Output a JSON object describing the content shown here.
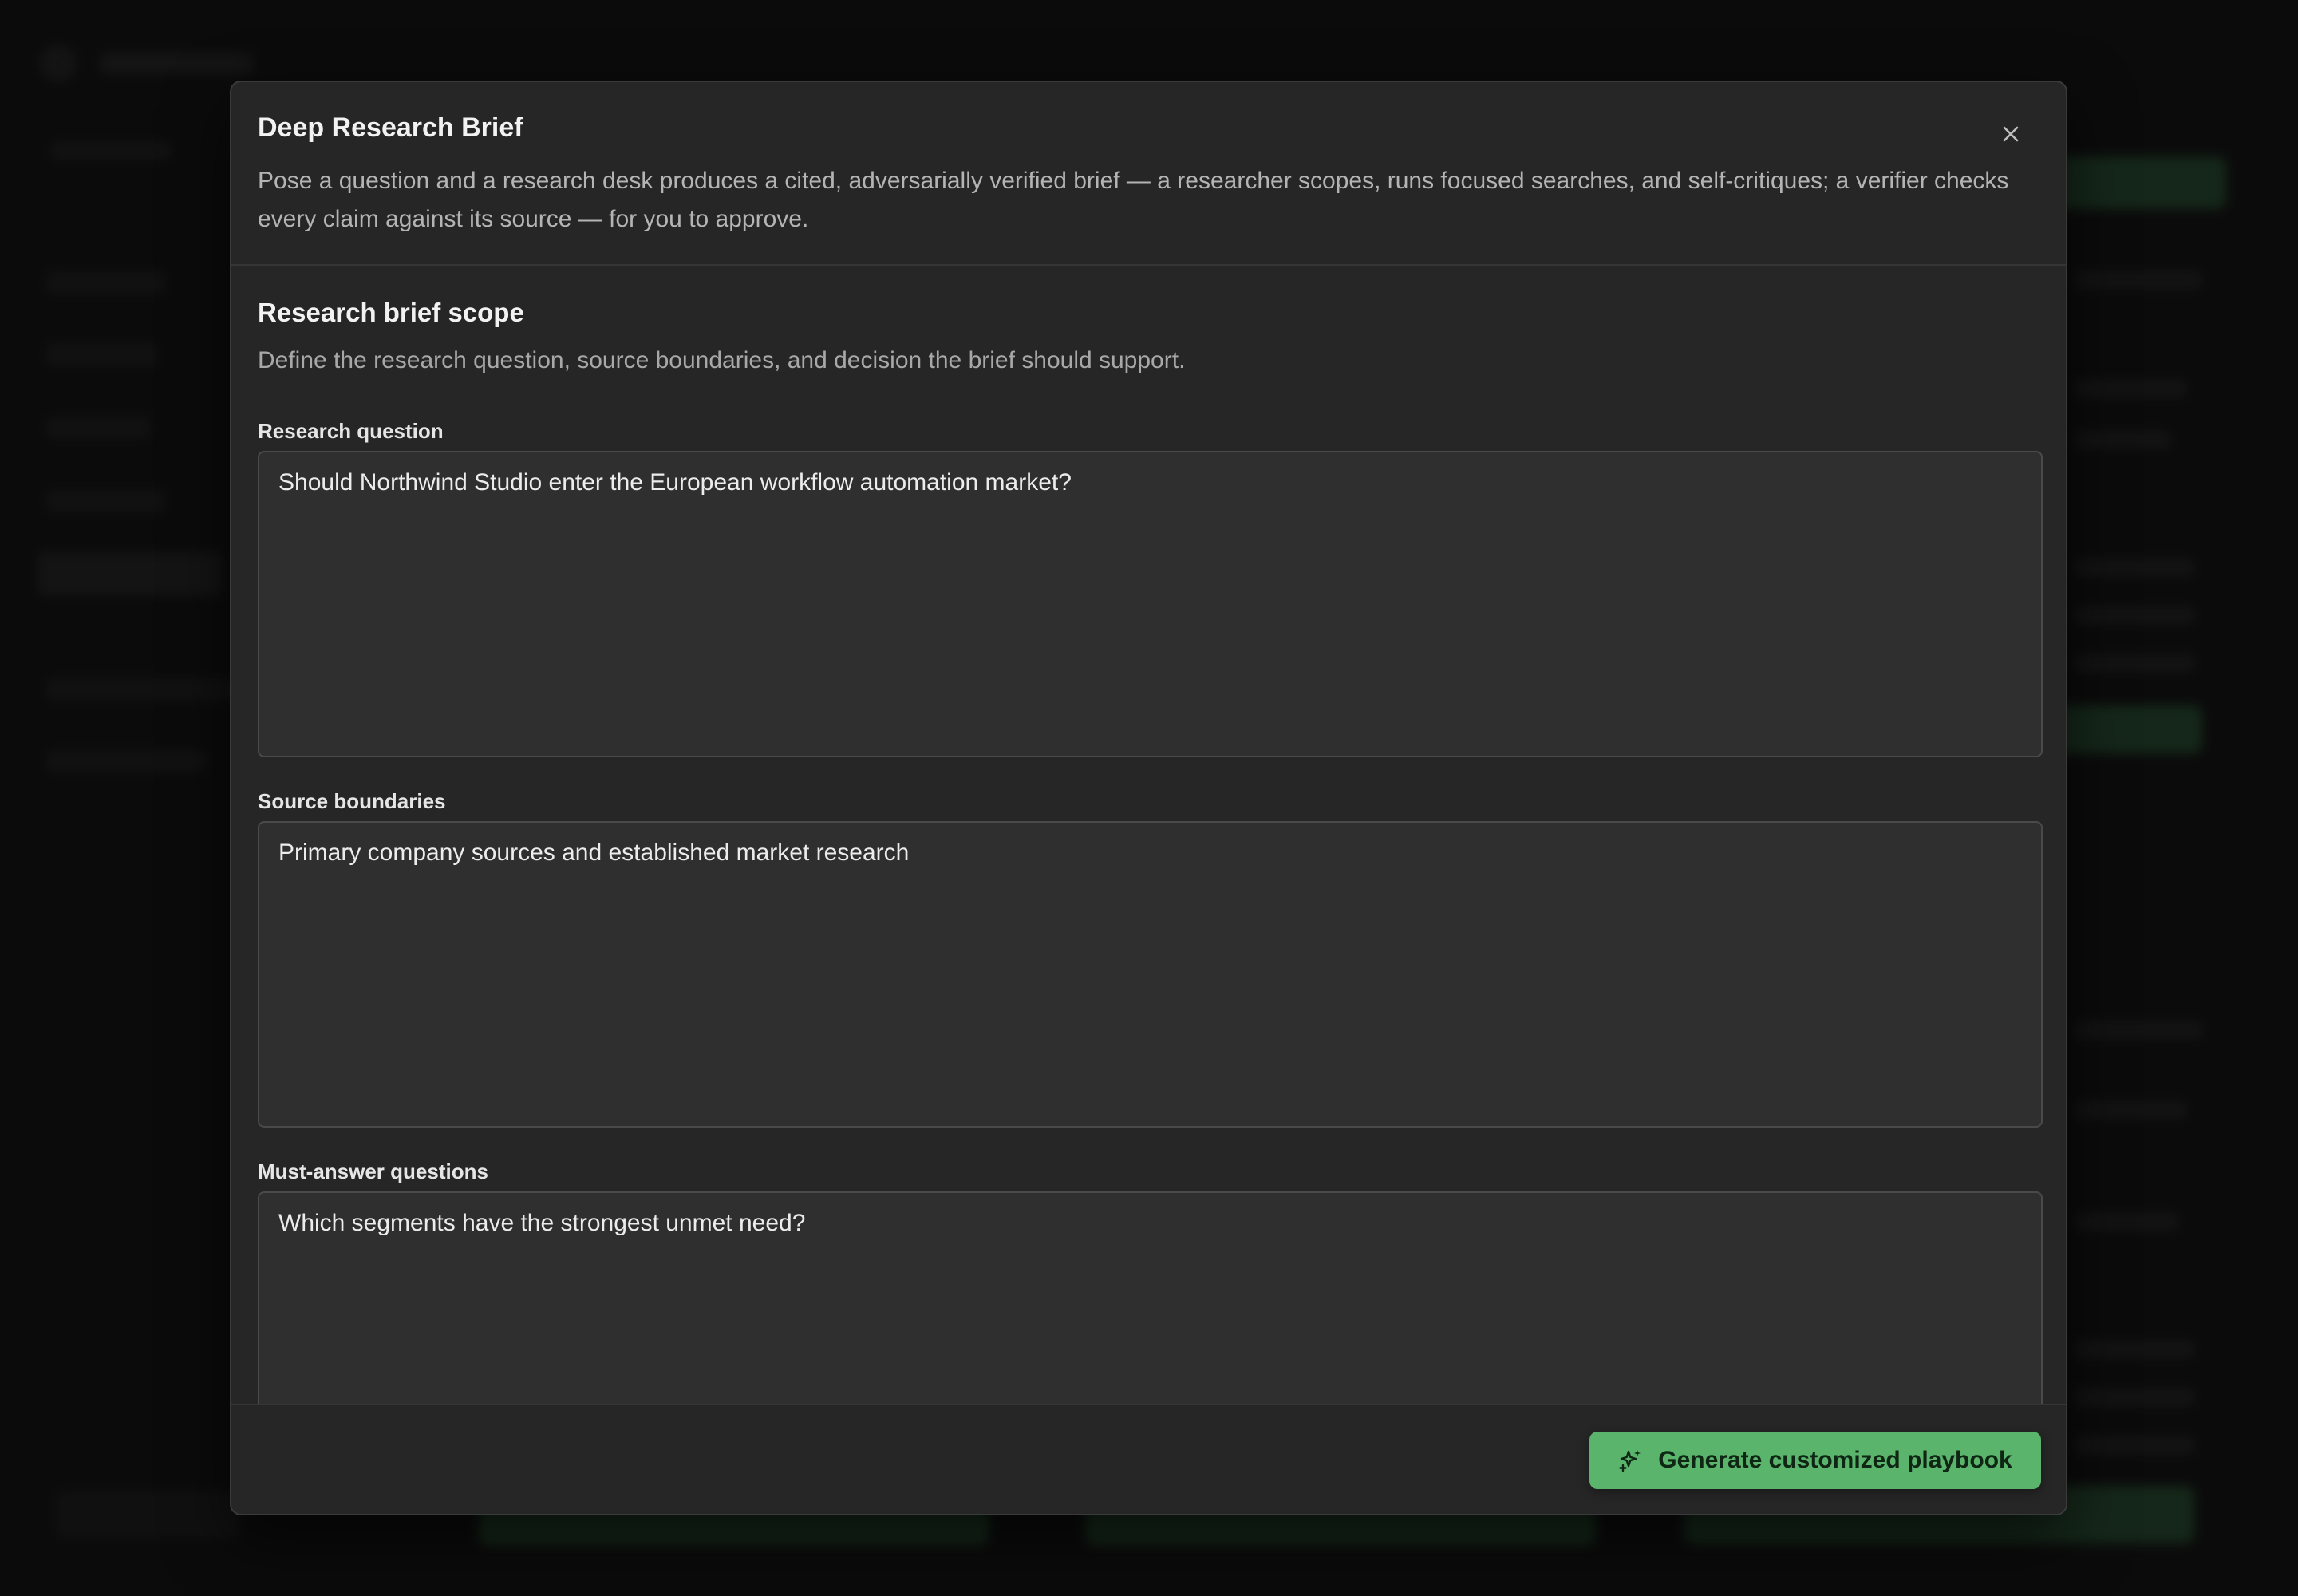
{
  "modal": {
    "title": "Deep Research Brief",
    "description": "Pose a question and a research desk produces a cited, adversarially verified brief — a researcher scopes, runs focused searches, and self-critiques; a verifier checks every claim against its source — for you to approve.",
    "close_icon": "close-icon"
  },
  "scope": {
    "title": "Research brief scope",
    "subtitle": "Define the research question, source boundaries, and decision the brief should support."
  },
  "fields": {
    "research_question": {
      "label": "Research question",
      "value": "Should Northwind Studio enter the European workflow automation market?"
    },
    "source_boundaries": {
      "label": "Source boundaries",
      "value": "Primary company sources and established market research"
    },
    "must_answer": {
      "label": "Must-answer questions",
      "value": "Which segments have the strongest unmet need?"
    }
  },
  "footer": {
    "primary_label": "Generate customized playbook",
    "primary_icon": "sparkles-icon"
  },
  "colors": {
    "accent": "#5ab46c",
    "modal_bg": "#262626",
    "field_bg": "#2f2f2f"
  }
}
